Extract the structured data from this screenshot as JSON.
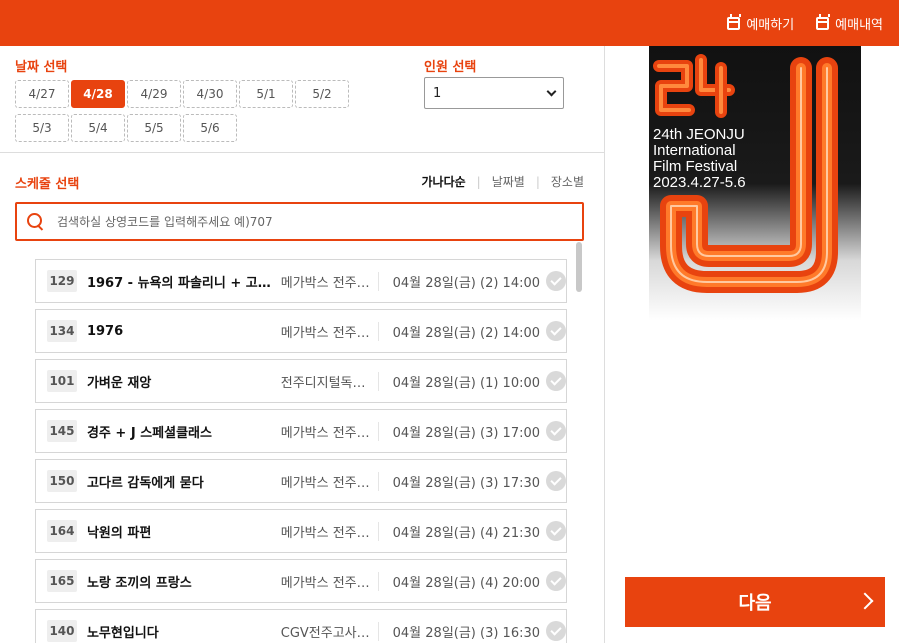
{
  "header": {
    "nav": [
      {
        "label": "예매하기",
        "icon": "calendar-icon"
      },
      {
        "label": "예매내역",
        "icon": "calendar-icon"
      }
    ]
  },
  "date_section": {
    "title": "날짜 선택",
    "dates": [
      "4/27",
      "4/28",
      "4/29",
      "4/30",
      "5/1",
      "5/2",
      "5/3",
      "5/4",
      "5/5",
      "5/6"
    ],
    "selected": "4/28"
  },
  "people_section": {
    "title": "인원 선택",
    "selected": "1"
  },
  "schedule_section": {
    "title": "스케줄 선택",
    "sort_tabs": [
      "가나다순",
      "날짜별",
      "장소별"
    ],
    "active_sort": "가나다순",
    "search_placeholder": "검색하실 상영코드를 입력해주세요 예)707"
  },
  "schedules": [
    {
      "code": "129",
      "title": "1967 - 뉴욕의 파솔리니 + 고…",
      "venue": "메가박스 전주…",
      "time": "04월 28일(금) (2) 14:00"
    },
    {
      "code": "134",
      "title": "1976",
      "venue": "메가박스 전주…",
      "time": "04월 28일(금) (2) 14:00"
    },
    {
      "code": "101",
      "title": "가벼운 재앙",
      "venue": "전주디지털독…",
      "time": "04월 28일(금) (1) 10:00"
    },
    {
      "code": "145",
      "title": "경주 + J 스페셜클래스",
      "venue": "메가박스 전주…",
      "time": "04월 28일(금) (3) 17:00"
    },
    {
      "code": "150",
      "title": "고다르 감독에게 묻다",
      "venue": "메가박스 전주…",
      "time": "04월 28일(금) (3) 17:30"
    },
    {
      "code": "164",
      "title": "낙원의 파편",
      "venue": "메가박스 전주…",
      "time": "04월 28일(금) (4) 21:30"
    },
    {
      "code": "165",
      "title": "노랑 조끼의 프랑스",
      "venue": "메가박스 전주…",
      "time": "04월 28일(금) (4) 20:00"
    },
    {
      "code": "140",
      "title": "노무현입니다",
      "venue": "CGV전주고사 …",
      "time": "04월 28일(금) (3) 16:30"
    }
  ],
  "poster": {
    "line1": "24th JEONJU",
    "line2": "International",
    "line3": "Film Festival",
    "line4": "2023.4.27-5.6"
  },
  "next_button": {
    "label": "다음"
  },
  "colors": {
    "accent": "#e8430f"
  }
}
